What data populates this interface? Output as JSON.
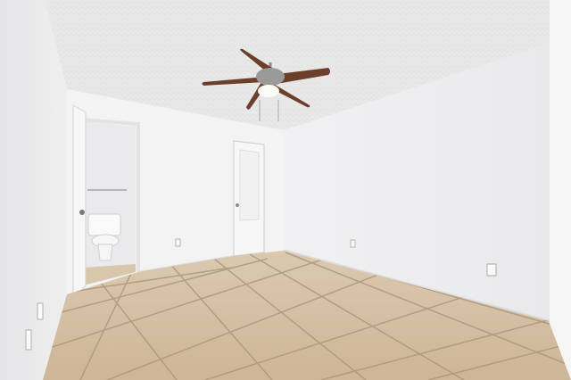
{
  "scene": {
    "description_free": true,
    "colors": {
      "ceiling": "#e6e6e6",
      "wall_left": "#f0f0f0",
      "wall_back": "#f4f4f4",
      "wall_right": "#f1f1f2",
      "floor_tile": "#d6c3a6",
      "grout": "#a8957a",
      "fan_blade": "#6b3f2a",
      "fan_metal": "#9a9a9a"
    },
    "icons": [
      "ceiling-fan-icon",
      "toilet-icon",
      "door-icon",
      "outlet-icon"
    ]
  }
}
